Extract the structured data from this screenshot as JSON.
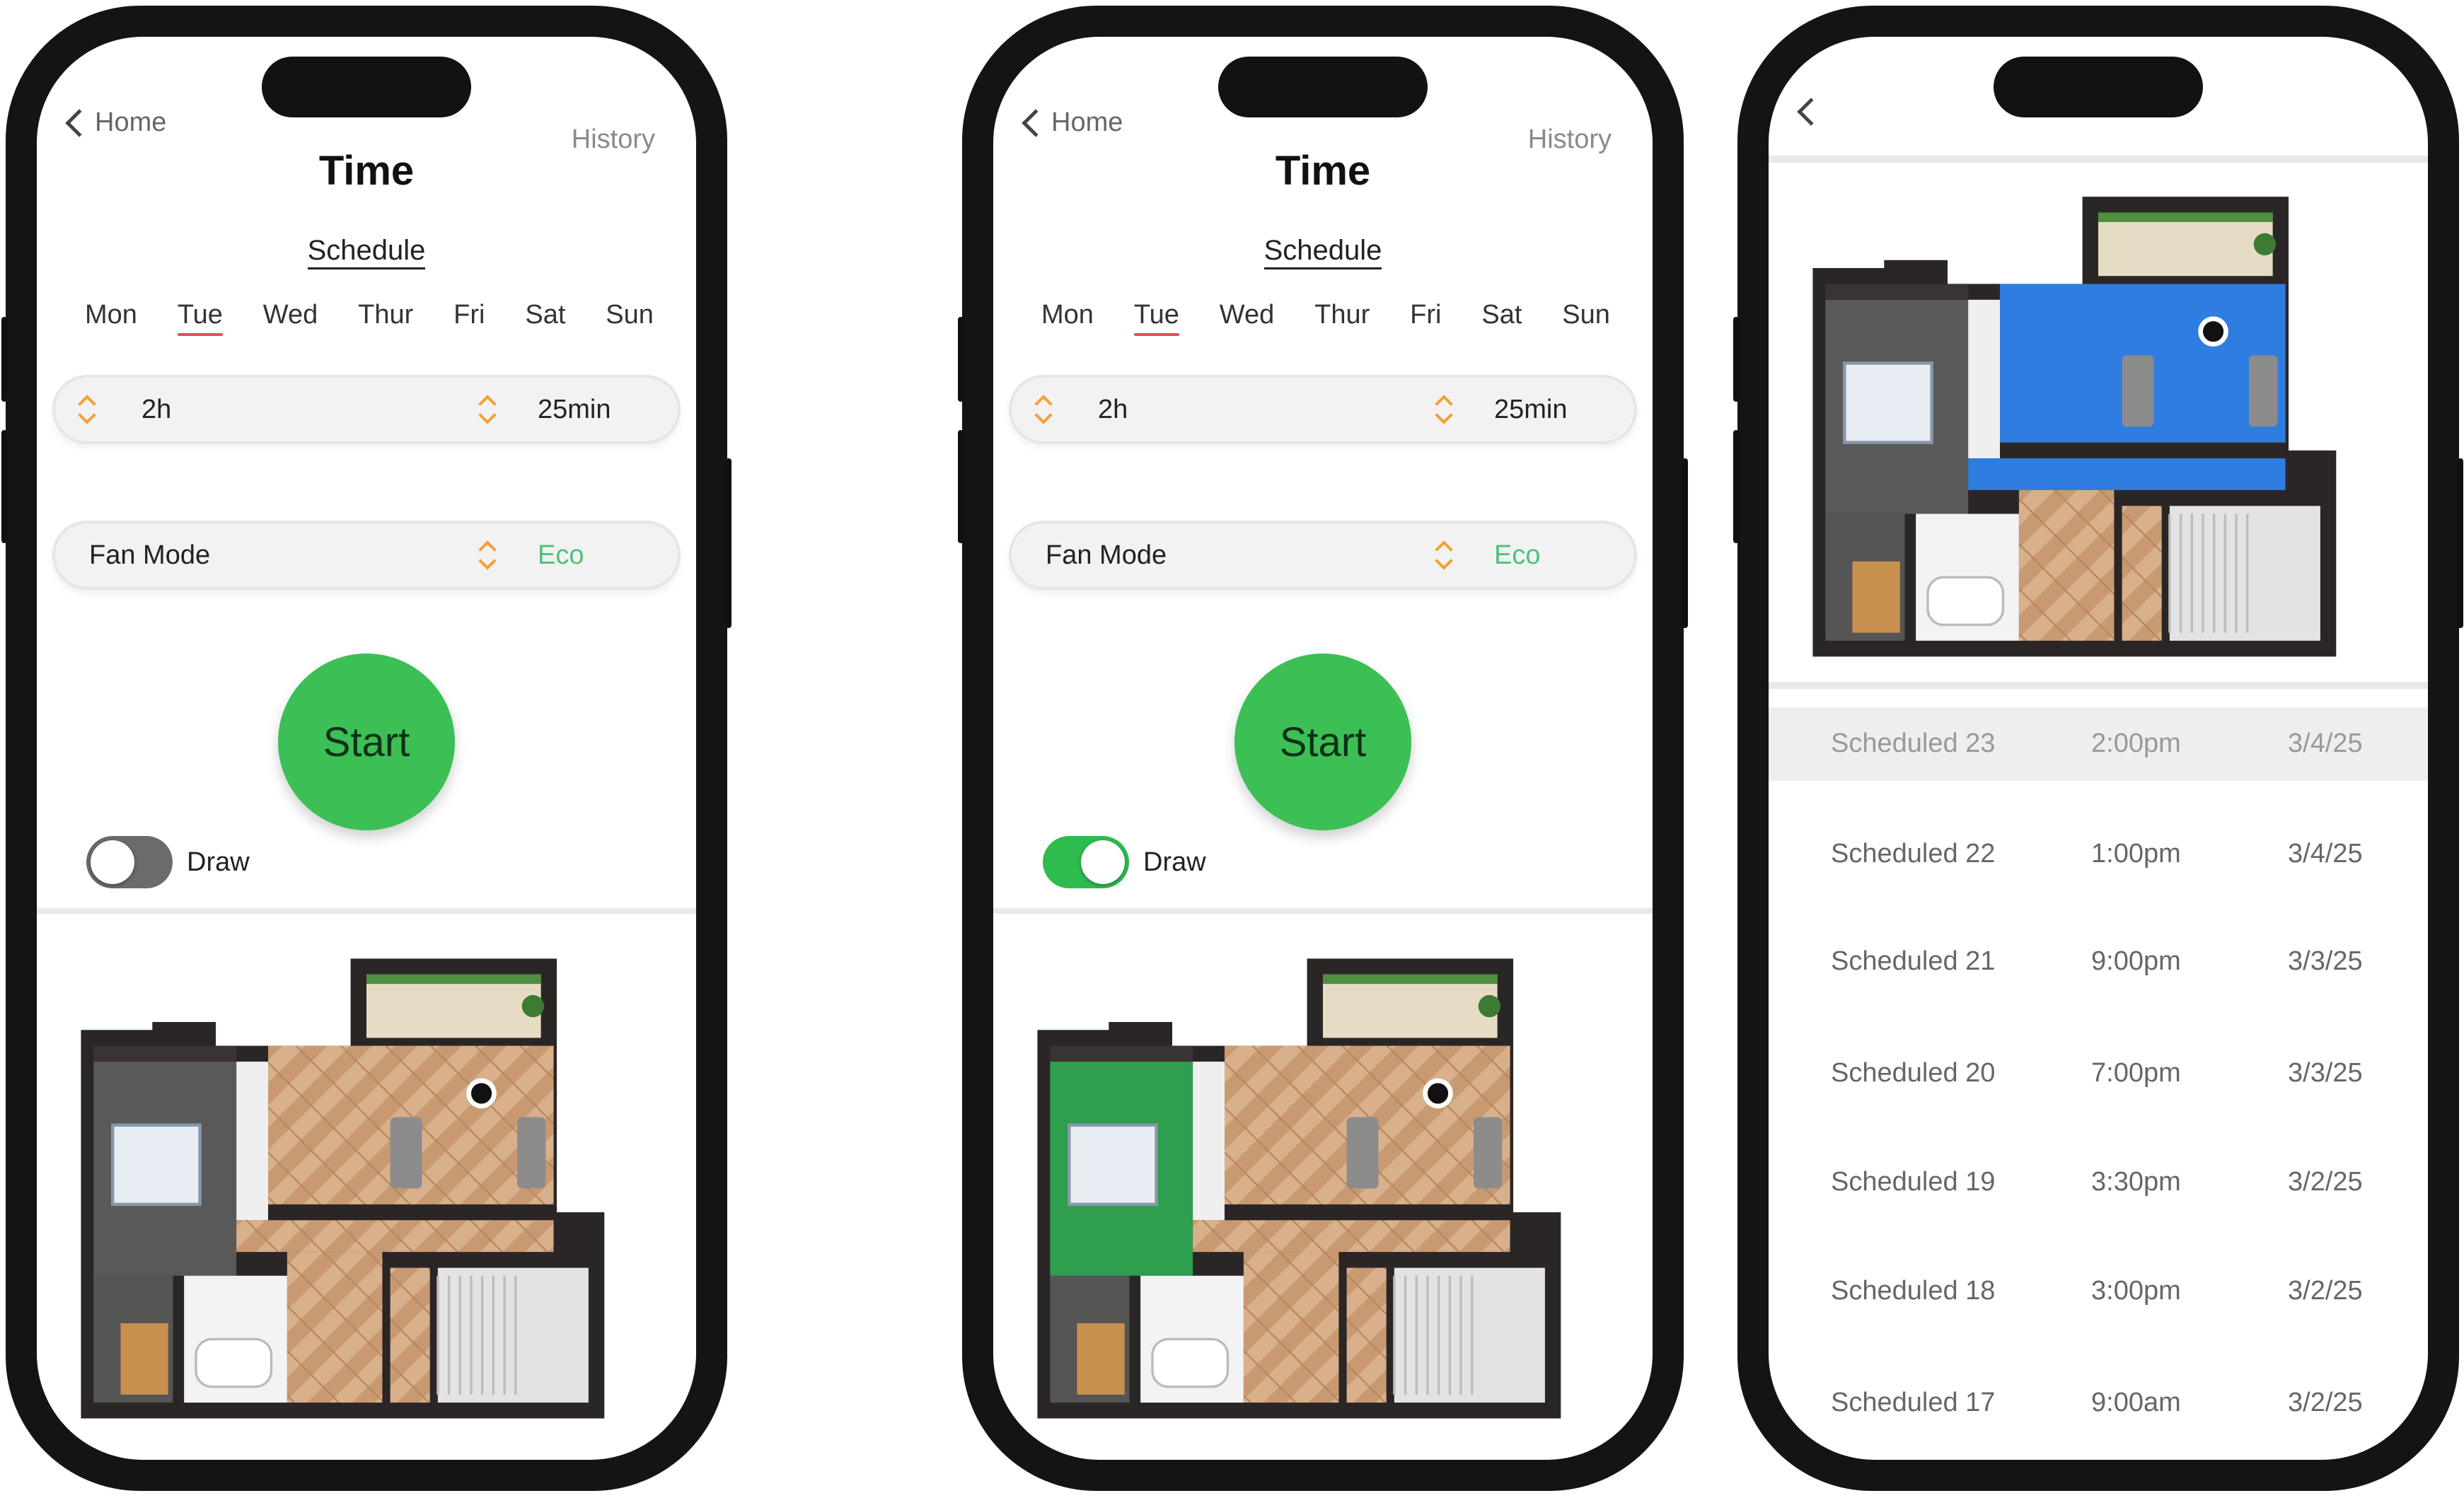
{
  "screens": [
    {
      "nav": {
        "back_label": "Home",
        "right_label": "History"
      },
      "title": "Time",
      "subtitle": "Schedule",
      "days": [
        "Mon",
        "Tue",
        "Wed",
        "Thur",
        "Fri",
        "Sat",
        "Sun"
      ],
      "selected_day": "Tue",
      "duration": {
        "hours": "2h",
        "minutes": "25min"
      },
      "fan_mode": {
        "label": "Fan Mode",
        "value": "Eco"
      },
      "start_label": "Start",
      "draw": {
        "label": "Draw",
        "enabled": false
      },
      "highlight_color": null
    },
    {
      "nav": {
        "back_label": "Home",
        "right_label": "History"
      },
      "title": "Time",
      "subtitle": "Schedule",
      "days": [
        "Mon",
        "Tue",
        "Wed",
        "Thur",
        "Fri",
        "Sat",
        "Sun"
      ],
      "selected_day": "Tue",
      "duration": {
        "hours": "2h",
        "minutes": "25min"
      },
      "fan_mode": {
        "label": "Fan Mode",
        "value": "Eco"
      },
      "start_label": "Start",
      "draw": {
        "label": "Draw",
        "enabled": true
      },
      "highlight_color": "#2e9e4f"
    }
  ],
  "history": {
    "highlight_color": "#2f7de1",
    "rows": [
      {
        "name": "Scheduled 23",
        "time": "2:00pm",
        "date": "3/4/25",
        "highlighted": true
      },
      {
        "name": "Scheduled 22",
        "time": "1:00pm",
        "date": "3/4/25",
        "highlighted": false
      },
      {
        "name": "Scheduled 21",
        "time": "9:00pm",
        "date": "3/3/25",
        "highlighted": false
      },
      {
        "name": "Scheduled 20",
        "time": "7:00pm",
        "date": "3/3/25",
        "highlighted": false
      },
      {
        "name": "Scheduled 19",
        "time": "3:30pm",
        "date": "3/2/25",
        "highlighted": false
      },
      {
        "name": "Scheduled 18",
        "time": "3:00pm",
        "date": "3/2/25",
        "highlighted": false
      },
      {
        "name": "Scheduled 17",
        "time": "9:00am",
        "date": "3/2/25",
        "highlighted": false
      }
    ]
  },
  "colors": {
    "accent_green": "#3cbf55",
    "eco_green": "#4cc27a",
    "stepper_orange": "#f2a03a",
    "selected_day_underline": "#e05050",
    "phone_frame": "#141414"
  },
  "icons": {
    "back": "chevron-left-icon",
    "stepper": "up-down-stepper-icon"
  }
}
